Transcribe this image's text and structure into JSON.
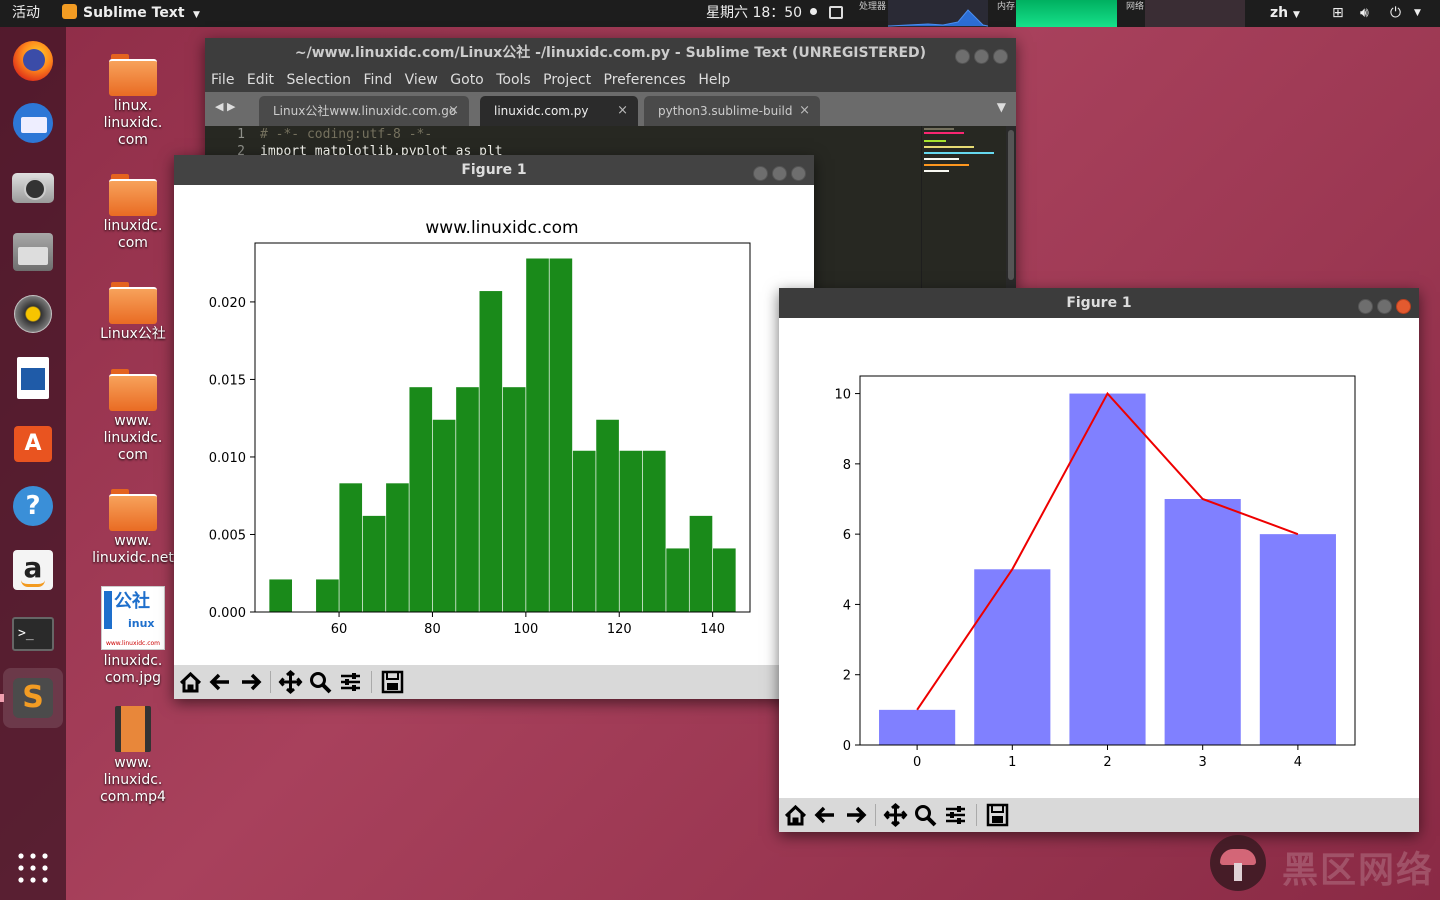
{
  "topbar": {
    "activities": "活动",
    "app_name": "Sublime Text",
    "clock": "星期六 18：50",
    "cpu_label": "处理器",
    "mem_label": "内存",
    "net_label": "网络",
    "lang": "zh"
  },
  "launcher": [
    "firefox-icon",
    "thunderbird-icon",
    "camera-icon",
    "files-icon",
    "rhythmbox-icon",
    "writer-icon",
    "software-icon",
    "help-icon",
    "amazon-icon",
    "terminal-icon",
    "sublime-icon"
  ],
  "desktop": [
    {
      "label": "linux.\nlinuxidc.\ncom",
      "kind": "folder"
    },
    {
      "label": "linuxidc.\ncom",
      "kind": "folder"
    },
    {
      "label": "Linux公社",
      "kind": "folder"
    },
    {
      "label": "www.\nlinuxidc.\ncom",
      "kind": "folder"
    },
    {
      "label": "www.\nlinuxidc.net",
      "kind": "folder"
    },
    {
      "label": "linuxidc.\ncom.jpg",
      "kind": "image",
      "thumb_text": "公社",
      "thumb_sub": "inux",
      "thumb_url": "www.linuxidc.com"
    },
    {
      "label": "www.\nlinuxidc.\ncom.mp4",
      "kind": "video"
    }
  ],
  "sublime": {
    "title": "~/www.linuxidc.com/Linux公社 -/linuxidc.com.py - Sublime Text (UNREGISTERED)",
    "menu": [
      "File",
      "Edit",
      "Selection",
      "Find",
      "View",
      "Goto",
      "Tools",
      "Project",
      "Preferences",
      "Help"
    ],
    "tabs": [
      {
        "label": "Linux公社www.linuxidc.com.go"
      },
      {
        "label": "linuxidc.com.py"
      },
      {
        "label": "python3.sublime-build"
      }
    ],
    "tab_close": "×",
    "lines": [
      {
        "n": "1",
        "text": "# -*- coding:utf-8 -*-"
      },
      {
        "n": "2",
        "text": "import matplotlib.pyplot as plt"
      }
    ]
  },
  "figure1": {
    "title": "Figure 1",
    "chart_data": {
      "type": "bar",
      "title": "www.linuxidc.com",
      "x": [
        47.5,
        52.5,
        57.5,
        62.5,
        67.5,
        72.5,
        77.5,
        82.5,
        87.5,
        92.5,
        97.5,
        102.5,
        107.5,
        112.5,
        117.5,
        122.5,
        127.5,
        132.5,
        137.5,
        142.5
      ],
      "bin_width": 4.85,
      "values": [
        0.0021,
        0,
        0.0021,
        0.0083,
        0.0062,
        0.0083,
        0.0145,
        0.0124,
        0.0145,
        0.0207,
        0.0145,
        0.0228,
        0.0228,
        0.0104,
        0.0124,
        0.0104,
        0.0104,
        0.0041,
        0.0062,
        0.0041
      ],
      "xlim": [
        42,
        148
      ],
      "ylim": [
        0,
        0.0238
      ],
      "xticks": [
        "60",
        "80",
        "100",
        "120",
        "140"
      ],
      "yticks": [
        "0.000",
        "0.005",
        "0.010",
        "0.015",
        "0.020"
      ],
      "color": "#1a8a1a"
    }
  },
  "figure2": {
    "title": "Figure 1",
    "chart_data": {
      "type": "bar",
      "categories": [
        "0",
        "1",
        "2",
        "3",
        "4"
      ],
      "values": [
        1,
        5,
        10,
        7,
        6
      ],
      "line_values": [
        1,
        5,
        10,
        7,
        6
      ],
      "ylim": [
        0,
        10.5
      ],
      "yticks": [
        "0",
        "2",
        "4",
        "6",
        "8",
        "10"
      ],
      "bar_color": "#8080ff",
      "line_color": "#ee0000"
    }
  },
  "watermark": "黑区网络"
}
